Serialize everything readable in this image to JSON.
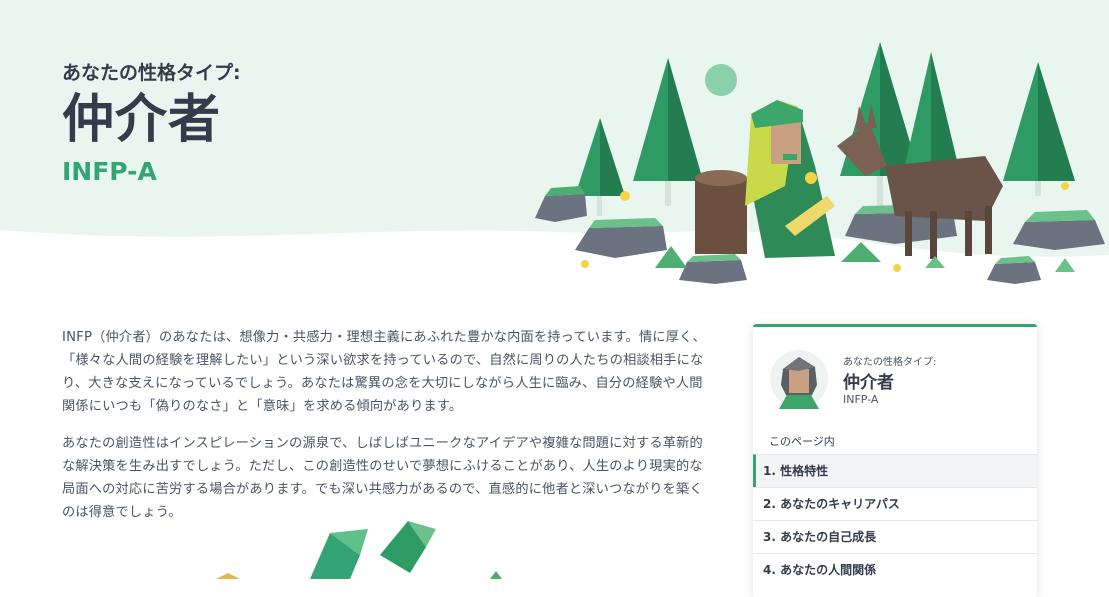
{
  "hero": {
    "subtitle": "あなたの性格タイプ:",
    "title": "仲介者",
    "code": "INFP-A"
  },
  "illustration": {
    "name": "forest-scene-with-girl-and-deer"
  },
  "content": {
    "paragraphs": [
      "INFP（仲介者）のあなたは、想像力・共感力・理想主義にあふれた豊かな内面を持っています。情に厚く、「様々な人間の経験を理解したい」という深い欲求を持っているので、自然に周りの人たちの相談相手になり、大きな支えになっているでしょう。あなたは驚異の念を大切にしながら人生に臨み、自分の経験や人間関係にいつも「偽りのなさ」と「意味」を求める傾向があります。",
      "あなたの創造性はインスピレーションの源泉で、しばしばユニークなアイデアや複雑な問題に対する革新的な解決策を生み出すでしょう。ただし、この創造性のせいで夢想にふけることがあり、人生のより現実的な局面への対応に苦労する場合があります。でも深い共感力があるので、直感的に他者と深いつながりを築くのは得意でしょう。"
    ]
  },
  "side_card": {
    "subtitle": "あなたの性格タイプ:",
    "title": "仲介者",
    "code": "INFP-A",
    "toc_heading": "このページ内",
    "toc": [
      {
        "label": "1. 性格特性",
        "active": true
      },
      {
        "label": "2. あなたのキャリアパス",
        "active": false
      },
      {
        "label": "3. あなたの自己成長",
        "active": false
      },
      {
        "label": "4. あなたの人間関係",
        "active": false
      }
    ]
  },
  "colors": {
    "accent": "#33a474",
    "hero_bg": "#e9f5ef",
    "text": "#343c4b"
  }
}
